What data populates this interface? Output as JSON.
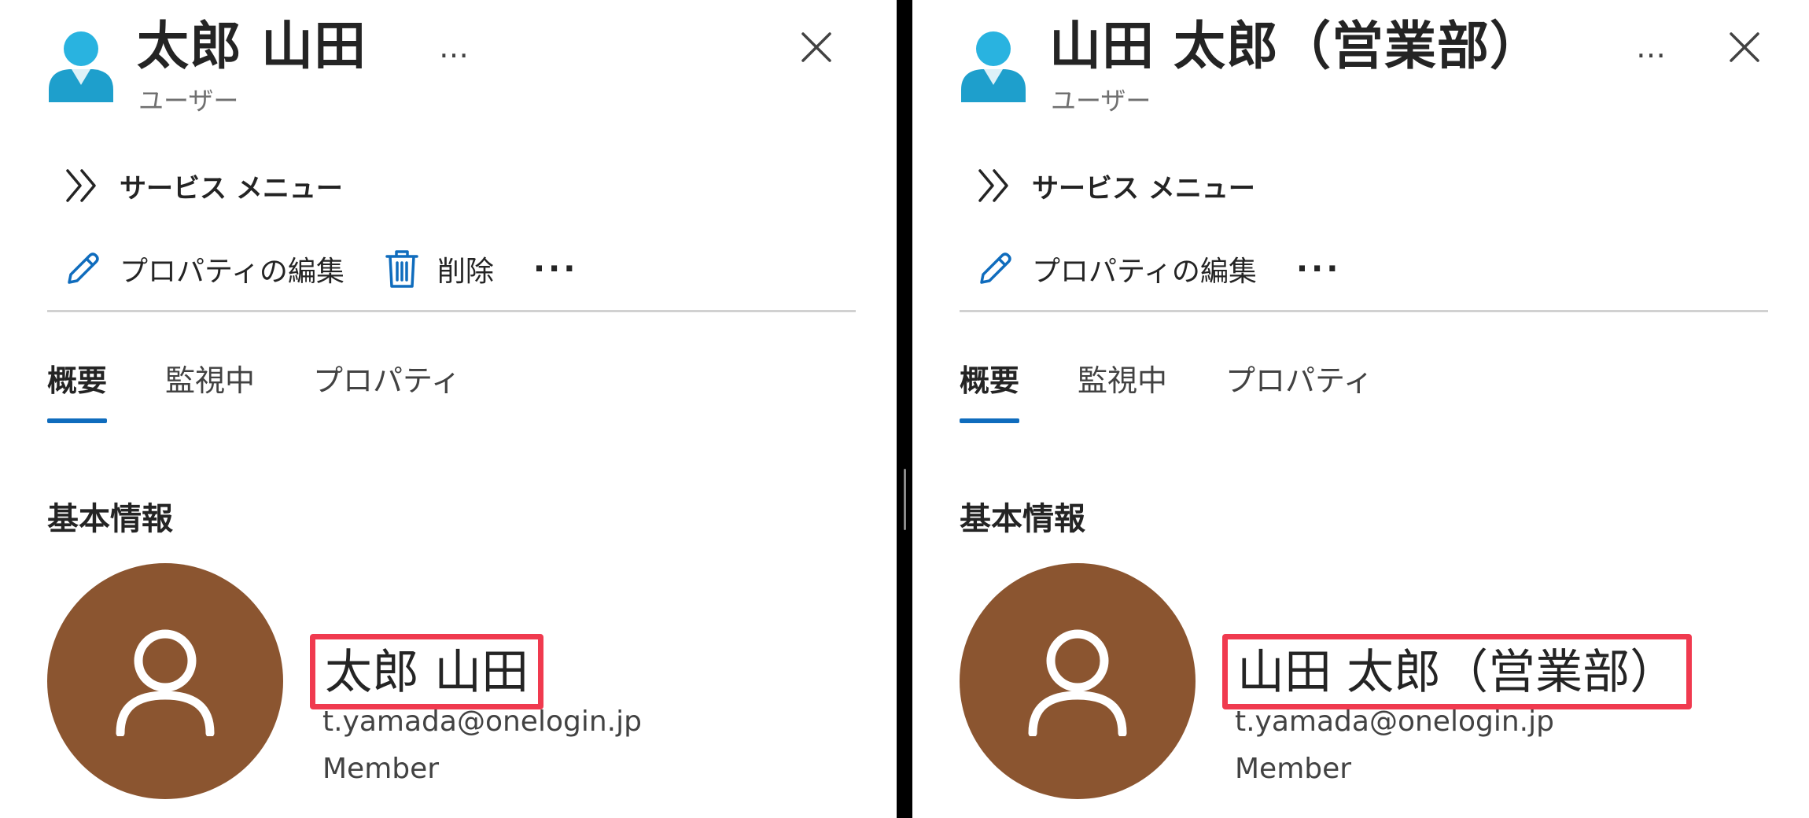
{
  "colors": {
    "accent": "#0f6cbd",
    "highlight": "#f03a4f",
    "avatar_bg": "#8b5530",
    "user_icon": "#29b3e0"
  },
  "left": {
    "title": "太郎 山田",
    "subtitle": "ユーザー",
    "title_more": "…",
    "service_menu": {
      "label": "サービス メニュー",
      "icon": "double-chevron-right-icon"
    },
    "commands": [
      {
        "label": "プロパティの編集",
        "icon": "pencil-icon"
      },
      {
        "label": "削除",
        "icon": "trash-icon"
      }
    ],
    "command_more": "···",
    "tabs": [
      {
        "label": "概要",
        "active": true
      },
      {
        "label": "監視中"
      },
      {
        "label": "プロパティ"
      }
    ],
    "section_title": "基本情報",
    "profile": {
      "name": "太郎 山田",
      "email": "t.yamada@onelogin.jp",
      "role": "Member"
    }
  },
  "right": {
    "title": "山田 太郎（営業部）",
    "subtitle": "ユーザー",
    "title_more": "…",
    "service_menu": {
      "label": "サービス メニュー",
      "icon": "double-chevron-right-icon"
    },
    "commands": [
      {
        "label": "プロパティの編集",
        "icon": "pencil-icon"
      }
    ],
    "command_more": "···",
    "tabs": [
      {
        "label": "概要",
        "active": true
      },
      {
        "label": "監視中"
      },
      {
        "label": "プロパティ"
      }
    ],
    "section_title": "基本情報",
    "profile": {
      "name": "山田 太郎（営業部）",
      "email": "t.yamada@onelogin.jp",
      "role": "Member"
    }
  }
}
